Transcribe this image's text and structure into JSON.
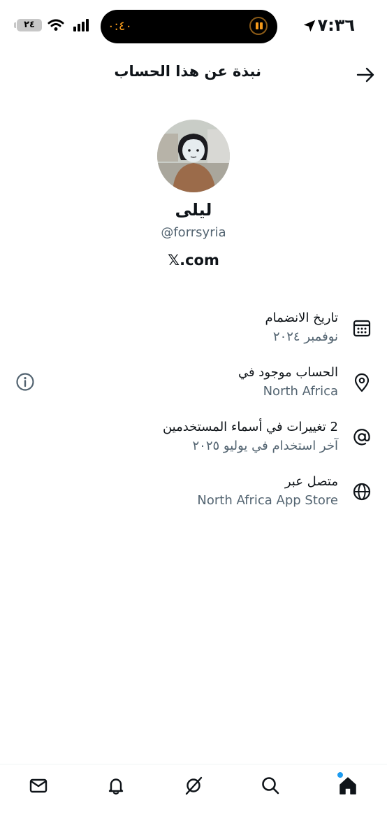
{
  "status_bar": {
    "time": "٧:٣٦",
    "island_timer": "٠:٤٠",
    "battery": "٢٤"
  },
  "header": {
    "title": "نبذة عن هذا الحساب"
  },
  "profile": {
    "display_name": "ليلى",
    "handle": "@forrsyria",
    "site": "𝕏.com"
  },
  "info_rows": [
    {
      "icon": "calendar-icon",
      "title": "تاريخ الانضمام",
      "subtitle": "نوفمبر ٢٠٢٤"
    },
    {
      "icon": "location-pin-icon",
      "title": "الحساب موجود في",
      "subtitle": "North Africa"
    },
    {
      "icon": "at-sign-icon",
      "title": "2 تغييرات في أسماء المستخدمين",
      "subtitle": "آخر استخدام في يوليو ٢٠٢٥"
    },
    {
      "icon": "globe-icon",
      "title": "متصل عبر",
      "subtitle": "North Africa App Store"
    }
  ],
  "bottom_nav": [
    "home-icon",
    "search-icon",
    "grok-icon",
    "notifications-icon",
    "messages-icon"
  ],
  "colors": {
    "text": "#0f1419",
    "secondary_text": "#536471",
    "accent": "#1d9bf0",
    "island_timer": "#f59a1b"
  }
}
